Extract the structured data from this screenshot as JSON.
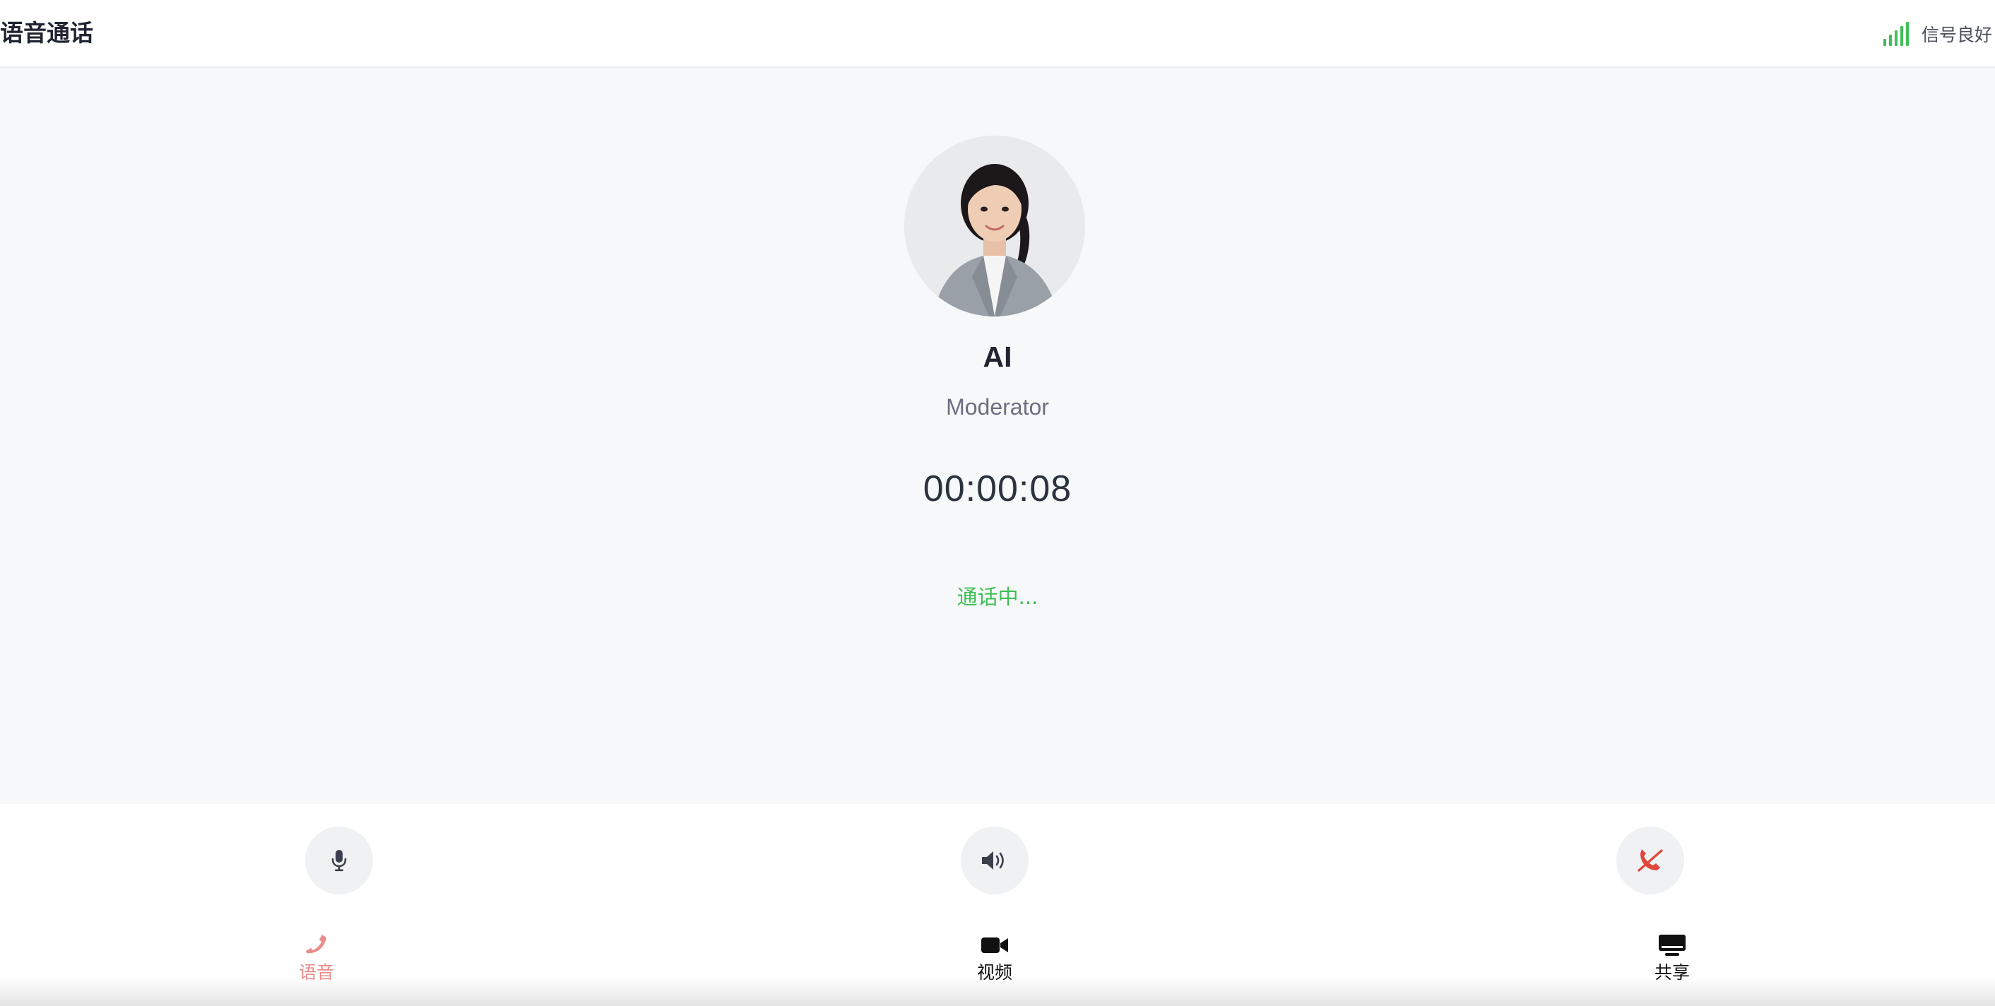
{
  "header": {
    "title": "语音通话",
    "signal_text": "信号良好"
  },
  "caller": {
    "name": "AI",
    "role": "Moderator",
    "timer": "00:00:08",
    "status": "通话中..."
  },
  "controls": {
    "mic_icon": "microphone-icon",
    "speaker_icon": "speaker-icon",
    "hangup_icon": "hang-up-icon"
  },
  "nav": {
    "items": [
      {
        "label": "语音",
        "icon": "phone-icon",
        "active": true
      },
      {
        "label": "视频",
        "icon": "video-camera-icon",
        "active": false
      },
      {
        "label": "共享",
        "icon": "monitor-icon",
        "active": false
      }
    ]
  },
  "colors": {
    "accent_green": "#3fbf55",
    "hangup_red": "#e0473c",
    "active_nav": "#e98c8c",
    "background": "#f7f8fa"
  }
}
